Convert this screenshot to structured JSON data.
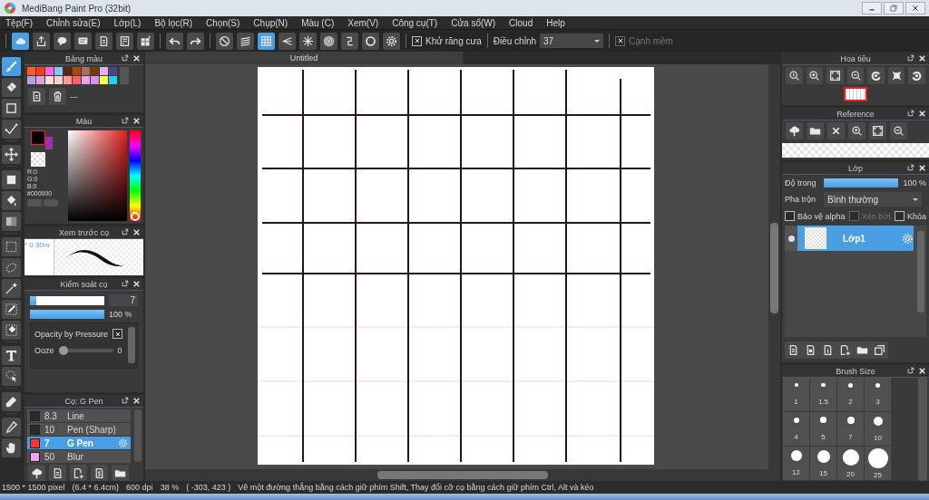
{
  "window": {
    "title": "MediBang Paint Pro (32bit)"
  },
  "menu": [
    "Tệp(F)",
    "Chỉnh sửa(E)",
    "Lớp(L)",
    "Bộ lọc(R)",
    "Chọn(S)",
    "Chụp(N)",
    "Màu (C)",
    "Xem(V)",
    "Công cụ(T)",
    "Cửa sổ(W)",
    "Cloud",
    "Help"
  ],
  "toolbar": {
    "snap_buttons": [
      {
        "selected": false
      },
      {
        "selected": false
      },
      {
        "selected": true
      },
      {
        "selected": false
      },
      {
        "selected": false
      },
      {
        "selected": false
      },
      {
        "selected": false
      },
      {
        "selected": false
      },
      {
        "selected": false
      }
    ],
    "antialias": {
      "label": "Khử răng cưa",
      "checked": true,
      "disabled": false
    },
    "adjust": {
      "label": "Điều chỉnh",
      "value": "37"
    },
    "soft_edge": {
      "label": "Cạnh mềm",
      "checked": true,
      "disabled": true
    }
  },
  "tools": [
    {
      "selected": true
    },
    {
      "selected": false
    },
    {
      "selected": false
    },
    {
      "selected": false
    },
    {
      "selected": false
    },
    {
      "selected": false
    },
    {
      "selected": false
    },
    {
      "selected": false
    },
    {
      "selected": false
    },
    {
      "selected": false
    },
    {
      "selected": false
    },
    {
      "selected": false
    },
    {
      "selected": false
    },
    {
      "selected": false
    },
    {
      "selected": false
    },
    {
      "selected": false
    },
    {
      "selected": false
    },
    {
      "selected": false
    }
  ],
  "palette": {
    "title": "Bảng màu",
    "swatches": [
      {
        "color": "#ff5a2a"
      },
      {
        "color": "#ff3b14"
      },
      {
        "color": "#ff66d9"
      },
      {
        "color": "#84c8f5"
      },
      {
        "color": "#5a2410"
      },
      {
        "color": "#a84a10"
      },
      {
        "color": "#a8705a"
      },
      {
        "color": "#7a3a10"
      },
      {
        "color": "#e0b0f0"
      },
      {
        "color": "#50408a"
      },
      {
        "color": "#b8a0e0"
      },
      {
        "color": "#e0a0e0"
      },
      {
        "color": "#ffe0d0"
      },
      {
        "color": "#ffd0d0"
      },
      {
        "color": "#ff9a9a"
      },
      {
        "color": "#ff6060"
      },
      {
        "color": "#e0a8e8"
      },
      {
        "color": "#d890f0"
      },
      {
        "color": "#ffff50"
      },
      {
        "color": "#20d0f0"
      }
    ],
    "empty_label": "---"
  },
  "color_panel": {
    "title": "Màu",
    "swatches": [
      {
        "kind": "foreground",
        "color": "#000000"
      },
      {
        "kind": "background",
        "color": "#a030a8"
      }
    ],
    "readouts": [
      "R:0",
      "G:0",
      "B:0",
      "#000000"
    ],
    "hue": {
      "level": 1
    }
  },
  "brush_preview": {
    "title": "Xem trước cọ",
    "size": "* 0.30m"
  },
  "brush_control": {
    "title": "Kiểm soát cọ",
    "size": {
      "level": 0.08,
      "value": "7"
    },
    "opacity": {
      "level": 1,
      "value": "100 %"
    },
    "pressure": {
      "label": "Opacity by Pressure",
      "checked": true
    },
    "ooze": {
      "label": "Ooze",
      "level": 0,
      "value": "0"
    }
  },
  "brushes": {
    "title": "Cọ: G Pen",
    "items": [
      {
        "size": "8.3",
        "name": "Line",
        "color": "#2a2a2a",
        "selected": false
      },
      {
        "size": "10",
        "name": "Pen (Sharp)",
        "color": "#2a2a2a",
        "selected": false
      },
      {
        "size": "7",
        "name": "G Pen",
        "color": "#ff3030",
        "selected": true
      },
      {
        "size": "50",
        "name": "Blur",
        "color": "#f0a0f0",
        "selected": false
      }
    ]
  },
  "canvas": {
    "tab": "Untitled"
  },
  "navigator": {
    "title": "Hoa tiêu"
  },
  "reference": {
    "title": "Reference"
  },
  "layers": {
    "title": "Lớp",
    "opacity": {
      "label": "Độ trong",
      "level": 1,
      "value": "100 %"
    },
    "blend": {
      "label": "Pha trộn",
      "value": "Bình thường"
    },
    "options": [
      {
        "label": "Bảo vệ alpha",
        "checked": false,
        "disabled": false
      },
      {
        "label": "Xén bớt",
        "checked": false,
        "disabled": true
      },
      {
        "label": "Khóa",
        "checked": false,
        "disabled": false
      }
    ],
    "items": [
      {
        "name": "Lớp1",
        "visible": true,
        "selected": true
      }
    ]
  },
  "brush_size": {
    "title": "Brush Size",
    "sizes": [
      "1",
      "1.5",
      "2",
      "3",
      "4",
      "5",
      "7",
      "10",
      "12",
      "15",
      "20",
      "25"
    ]
  },
  "status_bar": [
    "1500 * 1500 pixel",
    "(6.4 * 6.4cm)",
    "600 dpi",
    "38 %",
    "( -303, 423 )",
    "Vẽ một đường thẳng bằng cách giữ phím Shift, Thay đổi cỡ cọ bằng cách giữ phím Ctrl, Alt và kéo"
  ]
}
